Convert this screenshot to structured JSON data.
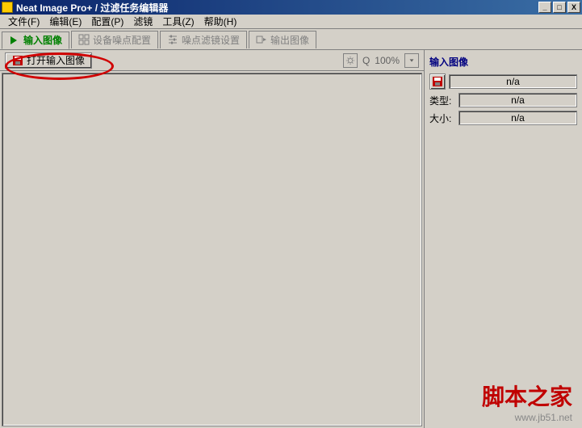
{
  "title": "Neat Image Pro+ / 过滤任务编辑器",
  "menus": {
    "file": "文件(F)",
    "edit": "编辑(E)",
    "config": "配置(P)",
    "filter": "滤镜",
    "tools": "工具(Z)",
    "help": "帮助(H)"
  },
  "tabs": {
    "input": "输入图像",
    "device": "设备噪点配置",
    "filter": "噪点滤镜设置",
    "output": "输出图像"
  },
  "buttons": {
    "open_input": "打开输入图像"
  },
  "zoom": {
    "level": "100%",
    "search_glyph": "Q"
  },
  "panel": {
    "title": "输入图像",
    "filename": "n/a",
    "type_label": "类型:",
    "type_value": "n/a",
    "size_label": "大小:",
    "size_value": "n/a"
  },
  "watermark": {
    "brand": "脚本之家",
    "url": "www.jb51.net"
  },
  "window_controls": {
    "min": "_",
    "max": "□",
    "close": "X"
  }
}
